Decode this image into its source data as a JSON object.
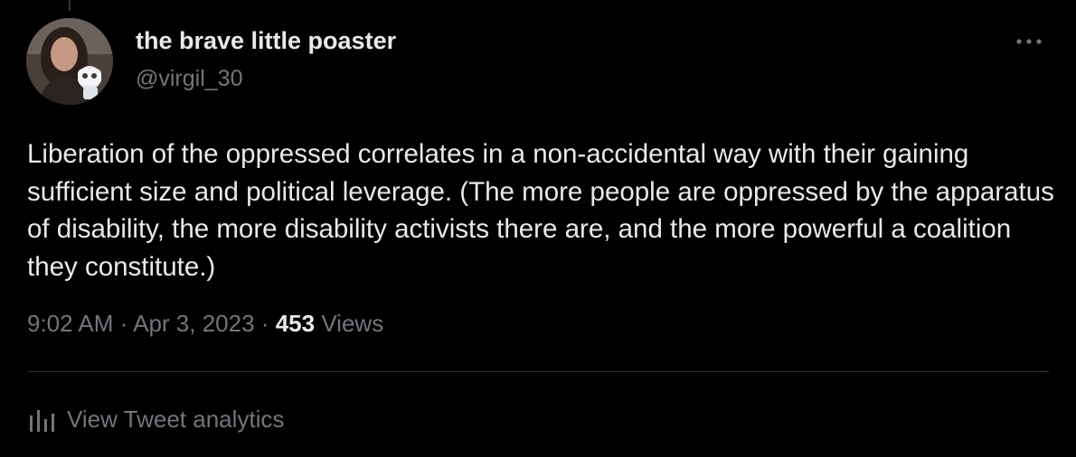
{
  "author": {
    "display_name": "the brave little poaster",
    "handle": "@virgil_30"
  },
  "tweet": {
    "text": "Liberation of the oppressed correlates in a non-accidental way with their gaining sufficient size and political leverage. (The more people are oppressed by the apparatus of disability, the more disability activists there are, and the more powerful a coalition they constitute.)",
    "time": "9:02 AM",
    "separator": "·",
    "date": "Apr 3, 2023",
    "views_count": "453",
    "views_label": "Views"
  },
  "actions": {
    "more_icon": "more-horizontal-icon",
    "analytics_icon": "bar-chart-icon",
    "analytics_label": "View Tweet analytics"
  },
  "colors": {
    "background": "#000000",
    "primary_text": "#e7e9ea",
    "secondary_text": "#71767b",
    "divider": "#2f3336"
  }
}
